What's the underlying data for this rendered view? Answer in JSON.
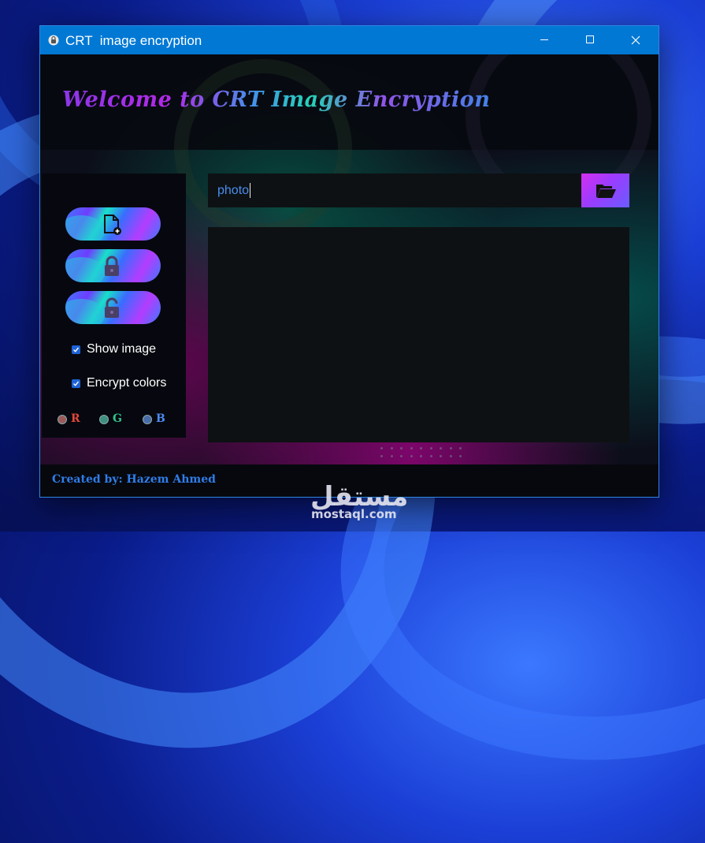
{
  "window": {
    "title": "CRT  image encryption",
    "icon": "app-lock-icon"
  },
  "titlebar_buttons": [
    "minimize-icon",
    "maximize-icon",
    "close-icon"
  ],
  "header": {
    "welcome": "Welcome to CRT Image Encryption"
  },
  "sidebar": {
    "buttons": [
      {
        "name": "add-file-button",
        "icon": "file-add-icon"
      },
      {
        "name": "encrypt-button",
        "icon": "lock-icon"
      },
      {
        "name": "decrypt-button",
        "icon": "unlock-icon"
      }
    ],
    "checkboxes": [
      {
        "label": "Show image",
        "checked": true
      },
      {
        "label": "Encrypt colors",
        "checked": true
      }
    ],
    "channels": [
      {
        "label": "R",
        "color": "#e2483a"
      },
      {
        "label": "G",
        "color": "#33c08c"
      },
      {
        "label": "B",
        "color": "#4a8af0"
      }
    ]
  },
  "path_input": {
    "value": "photo",
    "browse_icon": "folder-open-icon"
  },
  "footer": {
    "credit": "Created by: Hazem Ahmed"
  },
  "watermark": {
    "arabic": "مستقل",
    "latin": "mostaql.com"
  },
  "colors": {
    "titlebar": "#0078d4",
    "accent_text": "#2f7de8",
    "browse_gradient_start": "#d42ff0"
  }
}
